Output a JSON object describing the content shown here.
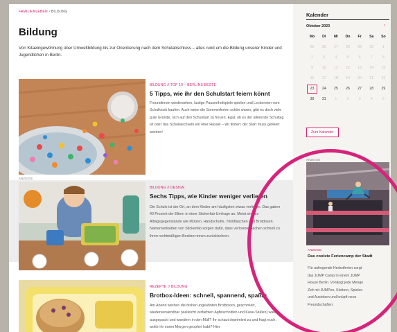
{
  "breadcrumb": {
    "home": "FAMILIENLEBEN",
    "separator": " › ",
    "current": "BILDUNG"
  },
  "page_title": "Bildung",
  "intro": "Von Kitaeingewöhnung über Umweltbildung bis zur Orientierung nach dem Schulabschluss – alles rund um die Bildung unserer Kinder und Jugendlichen in Berlin.",
  "articles": [
    {
      "category": "BILDUNG // TOP 10 – BERLINS BESTE",
      "title": "5 Tipps, wie ihr den Schulstart feiern könnt",
      "text": "Freundinnen wiedersehen, lustige Pausenhofspiele spielen und Leckereien vom Schulkiosk kaufen: Auch wenn die Sommerferien schön waren, gibt es doch viele gute Gründe, sich auf den Schulstart zu freuen. Egal, ob es der allererste Schultag ist oder das Schulwechseln ein eher Hassel – wir finden: der Start muss gefeiert werden!"
    },
    {
      "sponsored_label": "ANZEIGE",
      "category": "BILDUNG // DESIGN",
      "title": "Sechs Tipps, wie Kinder weniger verlieren",
      "text": "Die Schule ist der Ort, an dem Kinder am häufigsten etwas verlieren. Das gaben 40 Prozent der Eltern in einer Stickerfab-Umfrage an. Meist sind es Alltagsgegenstände wie Mützen, Handschuhe, Trinkflaschen und Brotdosen. Namensetiketten von Stickerfab sorgen dafür, dass verlorene Sachen schnell zu ihren rechtmäßigen Besitzer:innen zurückkehren."
    },
    {
      "category": "REZEPTE // BILDUNG",
      "title": "Brotbox-Ideen: schnell, spannend, spaßig",
      "text": "Am Abend werden die bisher ungeahnten Brotboxen, geschmiert, wiederverwendbar (vielleicht verfärbten Apfelschnitten und Käse-Stullen) wieder ausgepackt und wandern in den Müll? Ihr schaut deprimiert zu und fragt euch, wofür ihr euren Morgen geopfert habt? Hier"
    }
  ],
  "calendar": {
    "title": "Kalender",
    "month": "Oktober 2023",
    "next_icon": "›",
    "weekdays": [
      "Mo",
      "Di",
      "Mi",
      "Do",
      "Fr",
      "Sa",
      "So"
    ],
    "days": [
      "25",
      "26",
      "27",
      "28",
      "29",
      "30",
      "1",
      "2",
      "3",
      "4",
      "5",
      "6",
      "7",
      "8",
      "9",
      "10",
      "11",
      "12",
      "13",
      "14",
      "15",
      "16",
      "17",
      "18",
      "19",
      "20",
      "21",
      "22",
      "23",
      "24",
      "25",
      "26",
      "27",
      "28",
      "29",
      "30",
      "31",
      "1",
      "2",
      "3",
      "4",
      "5"
    ],
    "today": "23",
    "button": "Zum Kalender"
  },
  "ad": {
    "label": "ANZEIGE",
    "category": "ANZEIGE",
    "title": "Das coolste Feriencamp der Stadt",
    "text": "Für aufregende Herbstferien sorgt das JUMP Camp in einem JUMP House Berlin. Vorlängt jede Menge Zeit mit JUMPen, Klettern, Spielen und Austoben und knüpft neue Freundschaften."
  },
  "colors": {
    "accent": "#d6246f",
    "highlight_circle": "#d6247a"
  }
}
